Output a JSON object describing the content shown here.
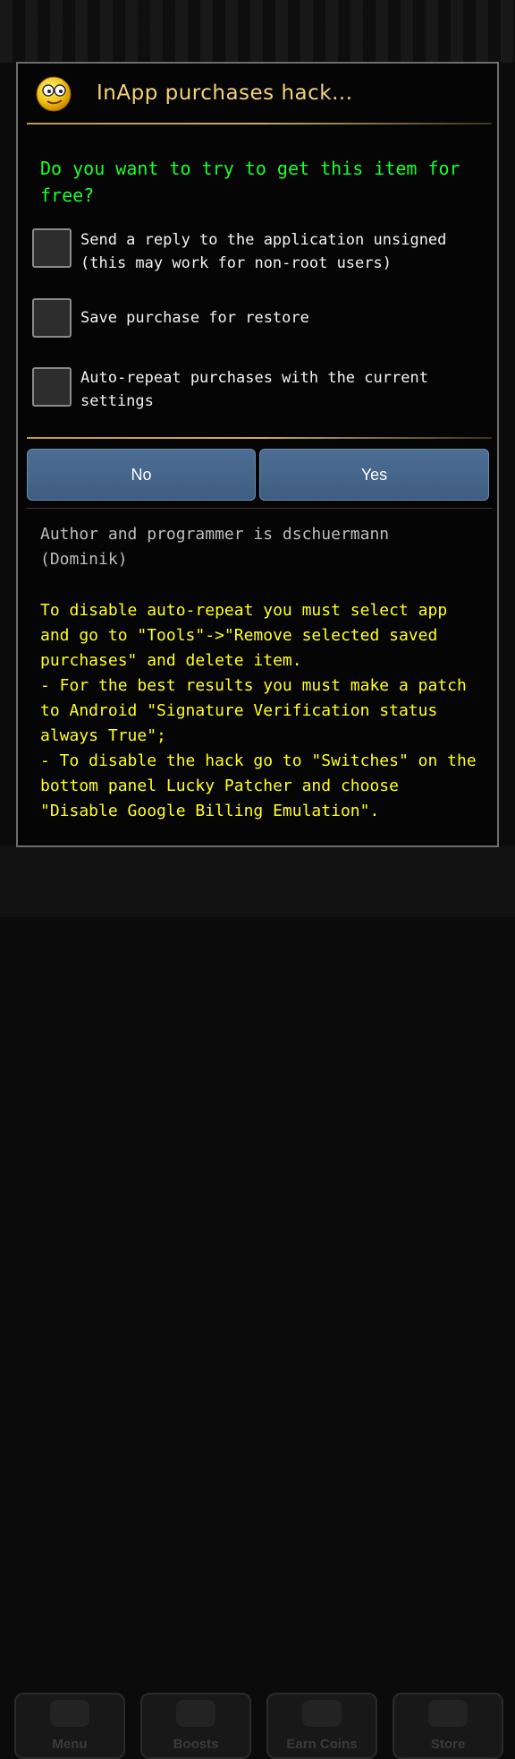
{
  "background": {
    "tabs": [
      "Menu",
      "Boosts",
      "Earn Coins",
      "Store"
    ]
  },
  "dialog": {
    "title": "InApp purchases hack...",
    "question": "Do you want to try to get this item for free?",
    "options": [
      {
        "label": "Send a reply to the application unsigned (this may work for non-root users)",
        "checked": false
      },
      {
        "label": "Save purchase for restore",
        "checked": false
      },
      {
        "label": "Auto-repeat purchases with the current settings",
        "checked": false
      }
    ],
    "buttons": {
      "no": "No",
      "yes": "Yes"
    },
    "author": "Author and programmer is dschuermann (Dominik)",
    "notes": "To disable auto-repeat you must select app and go to \"Tools\"->\"Remove selected saved purchases\" and delete item.\n- For the best results you must make a patch to Android \"Signature Verification status always True\";\n- To disable the hack go to \"Switches\" on the bottom panel Lucky Patcher and choose \"Disable Google Billing Emulation\"."
  },
  "colors": {
    "title": "#f2d27a",
    "question": "#18ff2f",
    "notes": "#ffff1e",
    "button": "#4a6a90"
  },
  "icons": {
    "title_icon": "nerd-smiley-icon"
  }
}
